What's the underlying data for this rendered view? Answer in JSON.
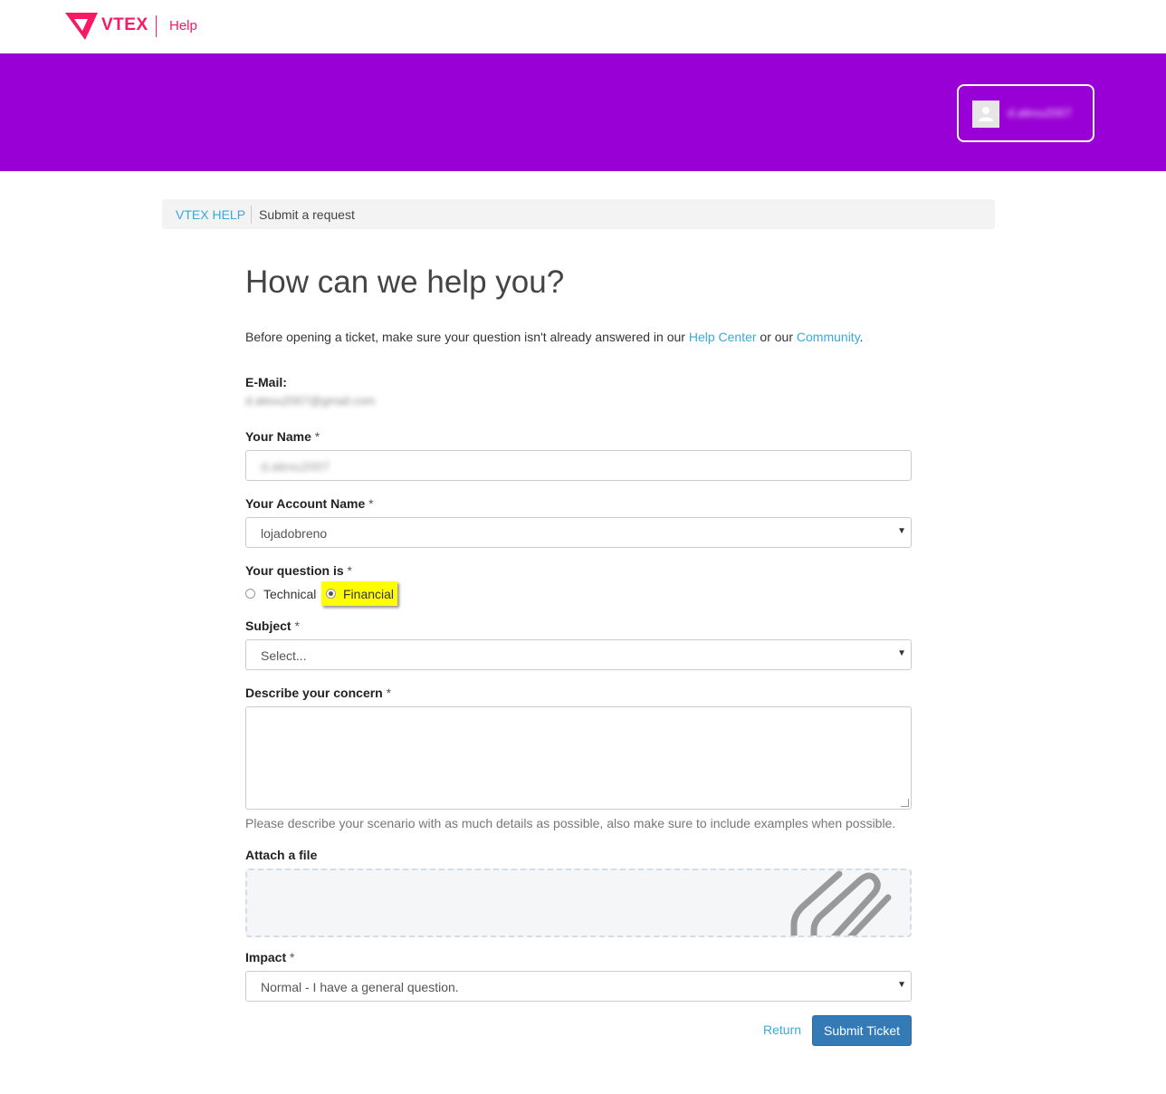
{
  "header": {
    "brand": "VTEX",
    "section": "Help",
    "user_name": "d.alexu2007"
  },
  "breadcrumb": {
    "home": "VTEX HELP",
    "current": "Submit a request"
  },
  "page": {
    "title": "How can we help you?",
    "intro_before": "Before opening a ticket, make sure your question isn't already answered in our ",
    "intro_link1": "Help Center",
    "intro_mid": " or our ",
    "intro_link2": "Community",
    "intro_after": "."
  },
  "form": {
    "required_mark": "*",
    "email": {
      "label": "E-Mail:",
      "value": "d.alexu2007@gmail.com"
    },
    "name": {
      "label": "Your Name",
      "value": "d.alexu2007"
    },
    "account": {
      "label": "Your Account Name",
      "value": "lojadobreno"
    },
    "question": {
      "label": "Your question is",
      "options": [
        "Technical",
        "Financial"
      ],
      "selected": "Financial"
    },
    "subject": {
      "label": "Subject",
      "value": "Select..."
    },
    "concern": {
      "label": "Describe your concern",
      "help": "Please describe your scenario with as much details as possible, also make sure to include examples when possible."
    },
    "attach": {
      "label": "Attach a file"
    },
    "impact": {
      "label": "Impact",
      "value": "Normal - I have a general question."
    },
    "return_label": "Return",
    "submit_label": "Submit Ticket"
  },
  "colors": {
    "brand_pink": "#f71963",
    "hero_purple": "#9900d5",
    "link_blue": "#3aa9d8",
    "button_blue": "#337ab7",
    "highlight_yellow": "#ffff00"
  },
  "icons": {
    "logo": "vtex-logo-icon",
    "avatar": "user-avatar-icon",
    "caret": "caret-down-icon",
    "attach": "paperclip-icon"
  }
}
